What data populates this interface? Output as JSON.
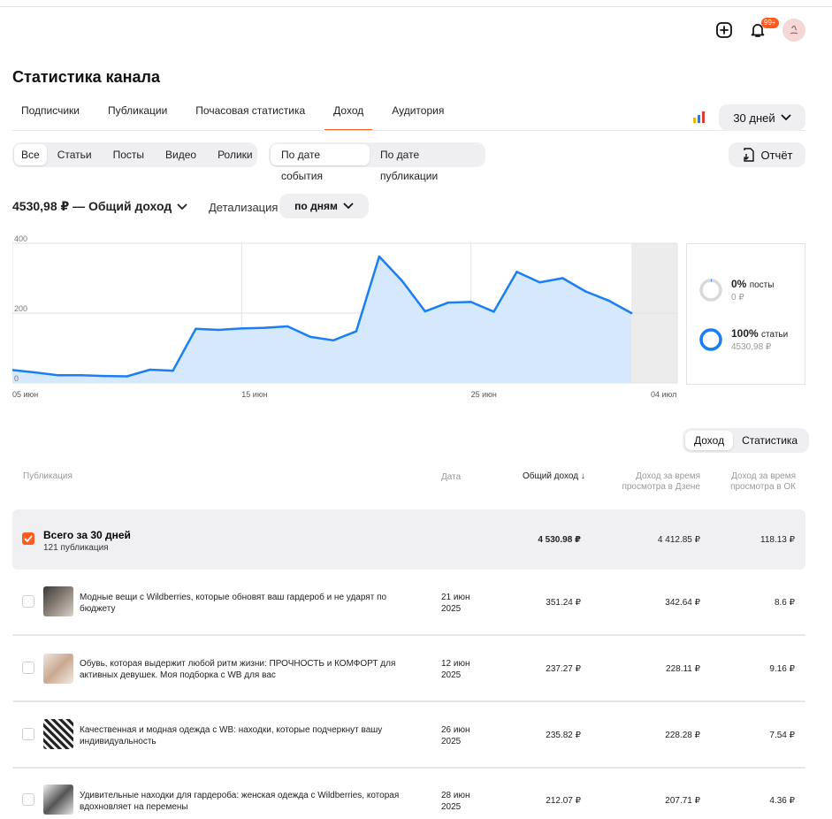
{
  "header": {
    "title": "Статистика канала",
    "notifications_badge": "99+",
    "tabs": [
      {
        "label": "Подписчики"
      },
      {
        "label": "Публикации"
      },
      {
        "label": "Почасовая статистика"
      },
      {
        "label": "Доход"
      },
      {
        "label": "Аудитория"
      }
    ],
    "active_tab": "Доход",
    "period_label": "30 дней"
  },
  "filters": {
    "types": [
      "Все",
      "Статьи",
      "Посты",
      "Видео",
      "Ролики"
    ],
    "selected_type": "Все",
    "date_modes": [
      "По дате события",
      "По дате публикации"
    ],
    "selected_date_mode": "По дате события",
    "report_label": "Отчёт"
  },
  "summary": {
    "total_label": "4530,98 ₽ — Общий доход",
    "detail_label": "Детализация",
    "detail_value": "по дням"
  },
  "chart_data": {
    "type": "area",
    "y_ticks": [
      "400",
      "200",
      "0"
    ],
    "ylim": [
      0,
      400
    ],
    "x_ticks": [
      "05 июн",
      "15 июн",
      "25 июн",
      "04 июл"
    ],
    "x": [
      "05 июн",
      "06 июн",
      "07 июн",
      "08 июн",
      "09 июн",
      "10 июн",
      "11 июн",
      "12 июн",
      "13 июн",
      "14 июн",
      "15 июн",
      "16 июн",
      "17 июн",
      "18 июн",
      "19 июн",
      "20 июн",
      "21 июн",
      "22 июн",
      "23 июн",
      "24 июн",
      "25 июн",
      "26 июн",
      "27 июн",
      "28 июн",
      "29 июн",
      "30 июн",
      "01 июл",
      "02 июл",
      "03 июл",
      "04 июл"
    ],
    "values": [
      37,
      30,
      22,
      22,
      20,
      19,
      38,
      35,
      155,
      152,
      156,
      158,
      162,
      132,
      122,
      148,
      362,
      292,
      205,
      230,
      232,
      204,
      318,
      288,
      300,
      262,
      236,
      200
    ],
    "color": "#1a7ef5",
    "fill": "#d6e8fb"
  },
  "donut": [
    {
      "pct": "0%",
      "label": "посты",
      "amount": "0 ₽",
      "fraction": 0.0
    },
    {
      "pct": "100%",
      "label": "статьи",
      "amount": "4530,98 ₽",
      "fraction": 1.0
    }
  ],
  "table": {
    "switch": [
      "Доход",
      "Статистика"
    ],
    "switch_selected": "Доход",
    "headers": {
      "publication": "Публикация",
      "date": "Дата",
      "total": "Общий доход",
      "dzen": "Доход за время просмотра в Дзене",
      "ok": "Доход за время просмотра в ОК"
    },
    "total_row": {
      "title": "Всего за 30 дней",
      "count": "121 публикация",
      "total": "4 530.98 ₽",
      "dzen": "4 412.85 ₽",
      "ok": "118.13 ₽"
    },
    "rows": [
      {
        "title": "Модные вещи с Wildberries, которые обновят ваш гардероб и не ударят по бюджету",
        "date": "21 июн 2025",
        "total": "351.24 ₽",
        "dzen": "342.64 ₽",
        "ok": "8.6 ₽"
      },
      {
        "title": "Обувь, которая выдержит любой ритм жизни: ПРОЧНОСТЬ и КОМФОРТ для активных девушек. Моя подборка с WB для вас",
        "date": "12 июн 2025",
        "total": "237.27 ₽",
        "dzen": "228.11 ₽",
        "ok": "9.16 ₽"
      },
      {
        "title": "Качественная и модная одежда с WB: находки, которые подчеркнут вашу индивидуальность",
        "date": "26 июн 2025",
        "total": "235.82 ₽",
        "dzen": "228.28 ₽",
        "ok": "7.54 ₽"
      },
      {
        "title": "Удивительные находки для гардероба: женская одежда с Wildberries, которая вдохновляет на перемены",
        "date": "28 июн 2025",
        "total": "212.07 ₽",
        "dzen": "207.71 ₽",
        "ok": "4.36 ₽"
      }
    ]
  },
  "colors": {
    "accent": "#ff5a1f",
    "chart_line": "#1a7ef5",
    "donut": "#1a7ef5"
  }
}
